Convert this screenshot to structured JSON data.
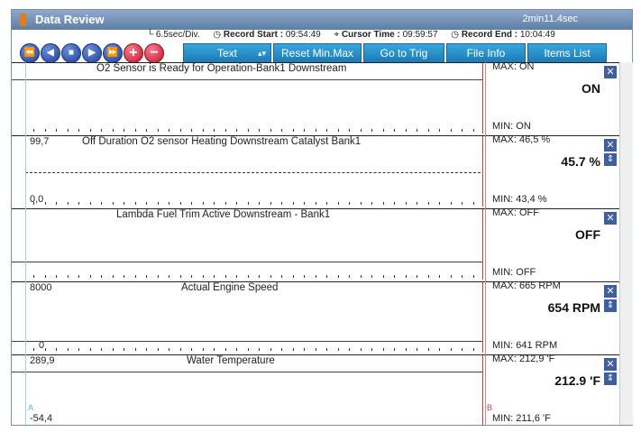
{
  "window": {
    "title": "Data Review",
    "elapsed": "2min11.4sec"
  },
  "info": {
    "scale": "6.5sec/Div.",
    "record_start_label": "Record Start :",
    "record_start_value": "09:54:49",
    "cursor_time_label": "Cursor Time :",
    "cursor_time_value": "09:59:57",
    "record_end_label": "Record End :",
    "record_end_value": "10:04:49"
  },
  "toolbar": {
    "text_label": "Text",
    "reset_label": "Reset Min.Max",
    "trig_label": "Go to Trig",
    "fileinfo_label": "File Info",
    "items_label": "Items List",
    "add_label": "+",
    "remove_label": "−"
  },
  "cursors": {
    "a_label": "A",
    "b_label": "B"
  },
  "channels": [
    {
      "name": "O2 Sensor is Ready for Operation-Bank1 Downstream",
      "hi": "",
      "lo": "",
      "max": "MAX: ON",
      "value": "ON",
      "min": "MIN: ON"
    },
    {
      "name": "Off Duration O2 sensor Heating Downstream Catalyst Bank1",
      "hi": "99,7",
      "lo": "0,0",
      "max": "MAX:  46,5 %",
      "value": "45.7 %",
      "min": "MIN:  43,4 %"
    },
    {
      "name": "Lambda Fuel Trim Active Downstream - Bank1",
      "hi": "",
      "lo": "",
      "max": "MAX: OFF",
      "value": "OFF",
      "min": "MIN: OFF"
    },
    {
      "name": "Actual Engine Speed",
      "hi": "8000",
      "lo": "0",
      "max": "MAX:    665 RPM",
      "value": "654 RPM",
      "min": "MIN:   641 RPM"
    },
    {
      "name": "Water Temperature",
      "hi": "289,9",
      "lo": "-54,4",
      "max": "MAX: 212,9 'F",
      "value": "212.9 'F",
      "min": "MIN: 211,6 'F"
    }
  ]
}
